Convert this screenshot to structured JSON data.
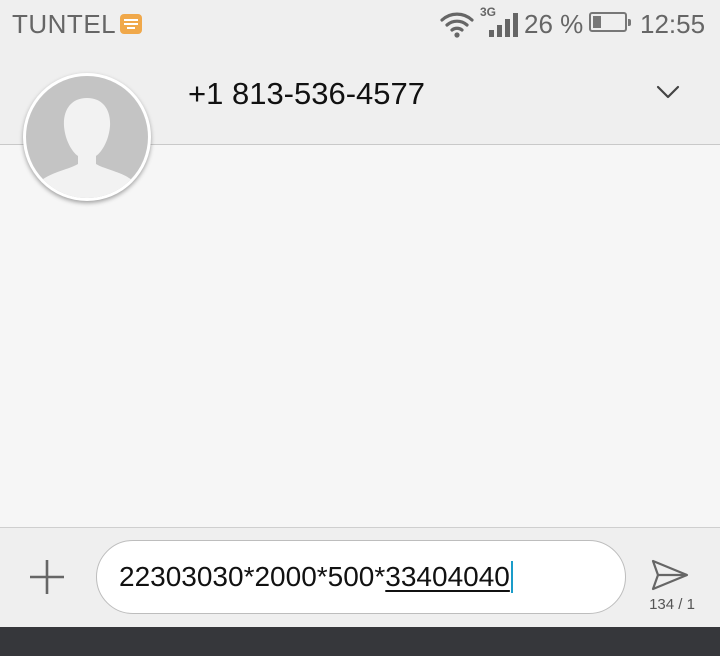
{
  "status_bar": {
    "carrier": "TUNTEL",
    "network_type": "3G",
    "battery_percent": "26 %",
    "battery_level": 0.26,
    "time": "12:55",
    "icons": [
      "keyboard-icon",
      "wifi-icon",
      "signal-icon",
      "battery-icon"
    ]
  },
  "header": {
    "contact": "+1 813-536-4577",
    "expand_icon": "chevron-down-icon"
  },
  "composer": {
    "message_text": "22303030*2000*500*",
    "composing_text": "33404040",
    "char_counter": "134 / 1",
    "add_icon": "plus-icon",
    "send_icon": "send-icon"
  },
  "colors": {
    "accent_cursor": "#1a9cc9",
    "keyboard_badge": "#f0a84a",
    "nav_bar": "#36373b"
  }
}
